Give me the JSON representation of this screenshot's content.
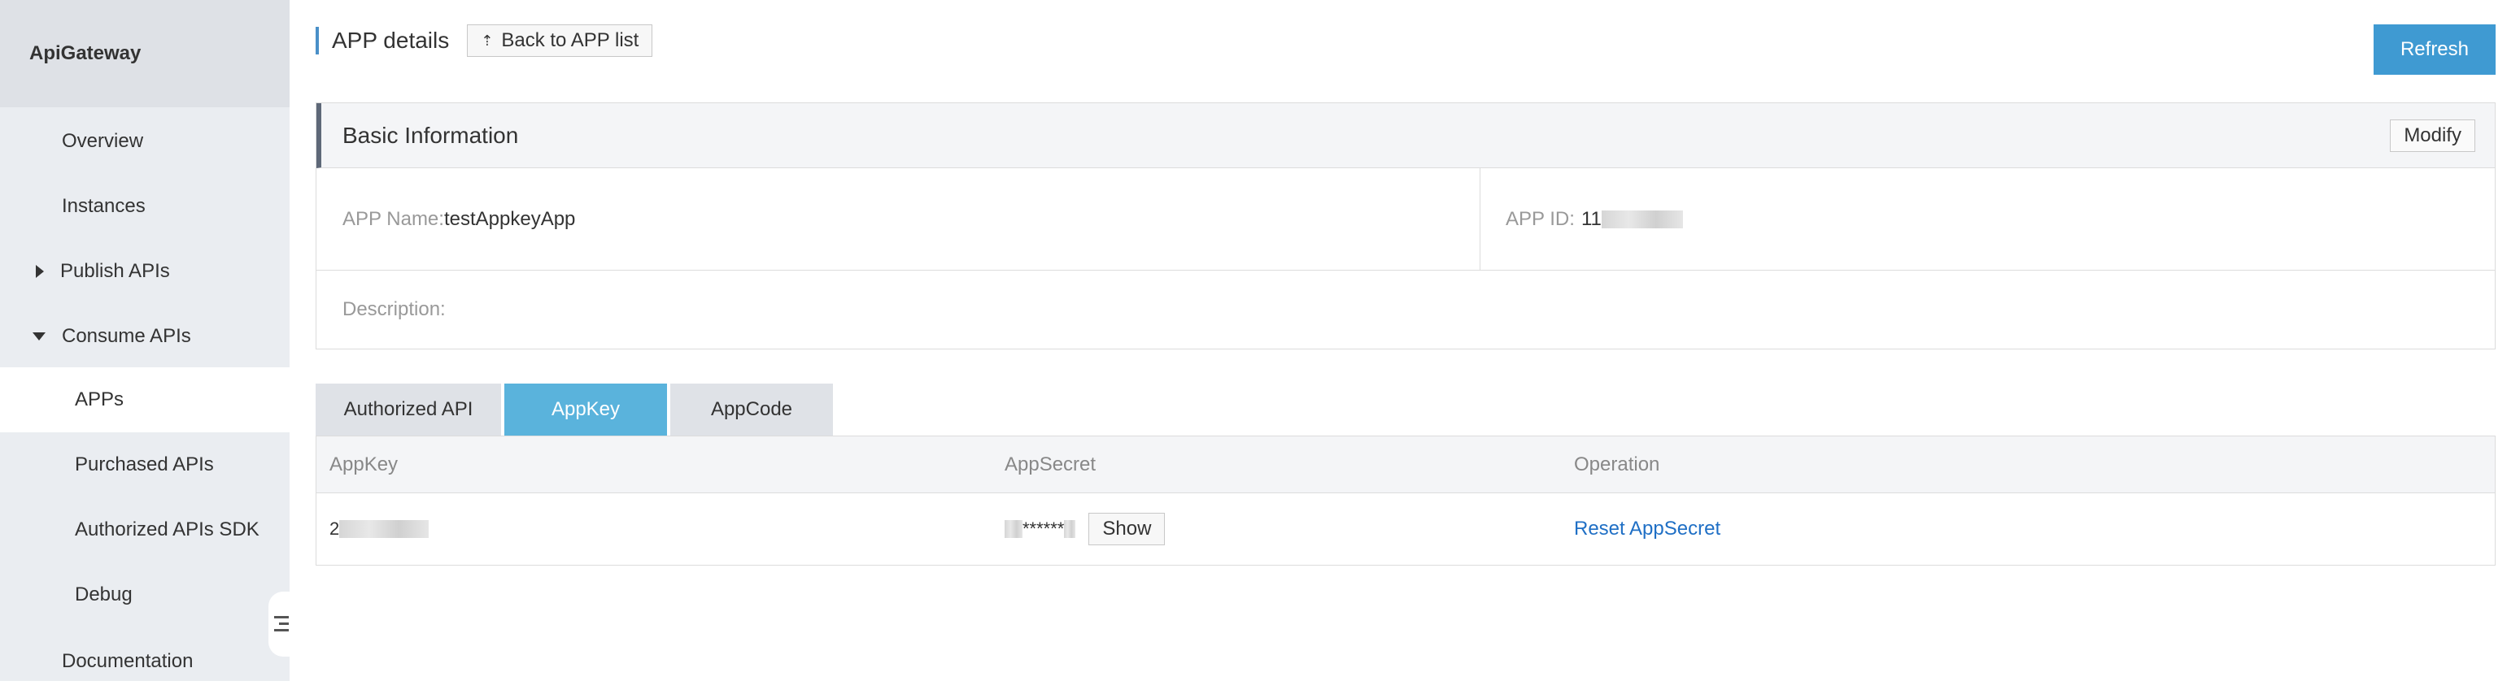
{
  "sidebar": {
    "title": "ApiGateway",
    "items": [
      {
        "label": "Overview"
      },
      {
        "label": "Instances"
      },
      {
        "label": "Publish APIs"
      },
      {
        "label": "Consume APIs"
      },
      {
        "label": "APPs"
      },
      {
        "label": "Purchased APIs"
      },
      {
        "label": "Authorized APIs SDK"
      },
      {
        "label": "Debug"
      },
      {
        "label": "Documentation"
      }
    ],
    "collapse_icon": "collapse-menu-icon"
  },
  "header": {
    "title": "APP details",
    "back_label": "Back to APP list",
    "back_icon": "upload-arrow-icon",
    "refresh_label": "Refresh"
  },
  "basic_info": {
    "title": "Basic Information",
    "modify_label": "Modify",
    "app_name_label": "APP Name:",
    "app_name_value": "testAppkeyApp",
    "app_id_label": "APP ID:",
    "app_id_value": "11",
    "description_label": "Description:"
  },
  "tabs": [
    {
      "label": "Authorized API"
    },
    {
      "label": "AppKey"
    },
    {
      "label": "AppCode"
    }
  ],
  "table": {
    "columns": [
      "AppKey",
      "AppSecret",
      "Operation"
    ],
    "rows": [
      {
        "appkey": "2",
        "appsecret": "******",
        "show_label": "Show",
        "operation": "Reset AppSecret"
      }
    ]
  },
  "colors": {
    "accent": "#3f9ad2",
    "active_tab": "#5ab3dc",
    "link": "#1f6fc5"
  }
}
